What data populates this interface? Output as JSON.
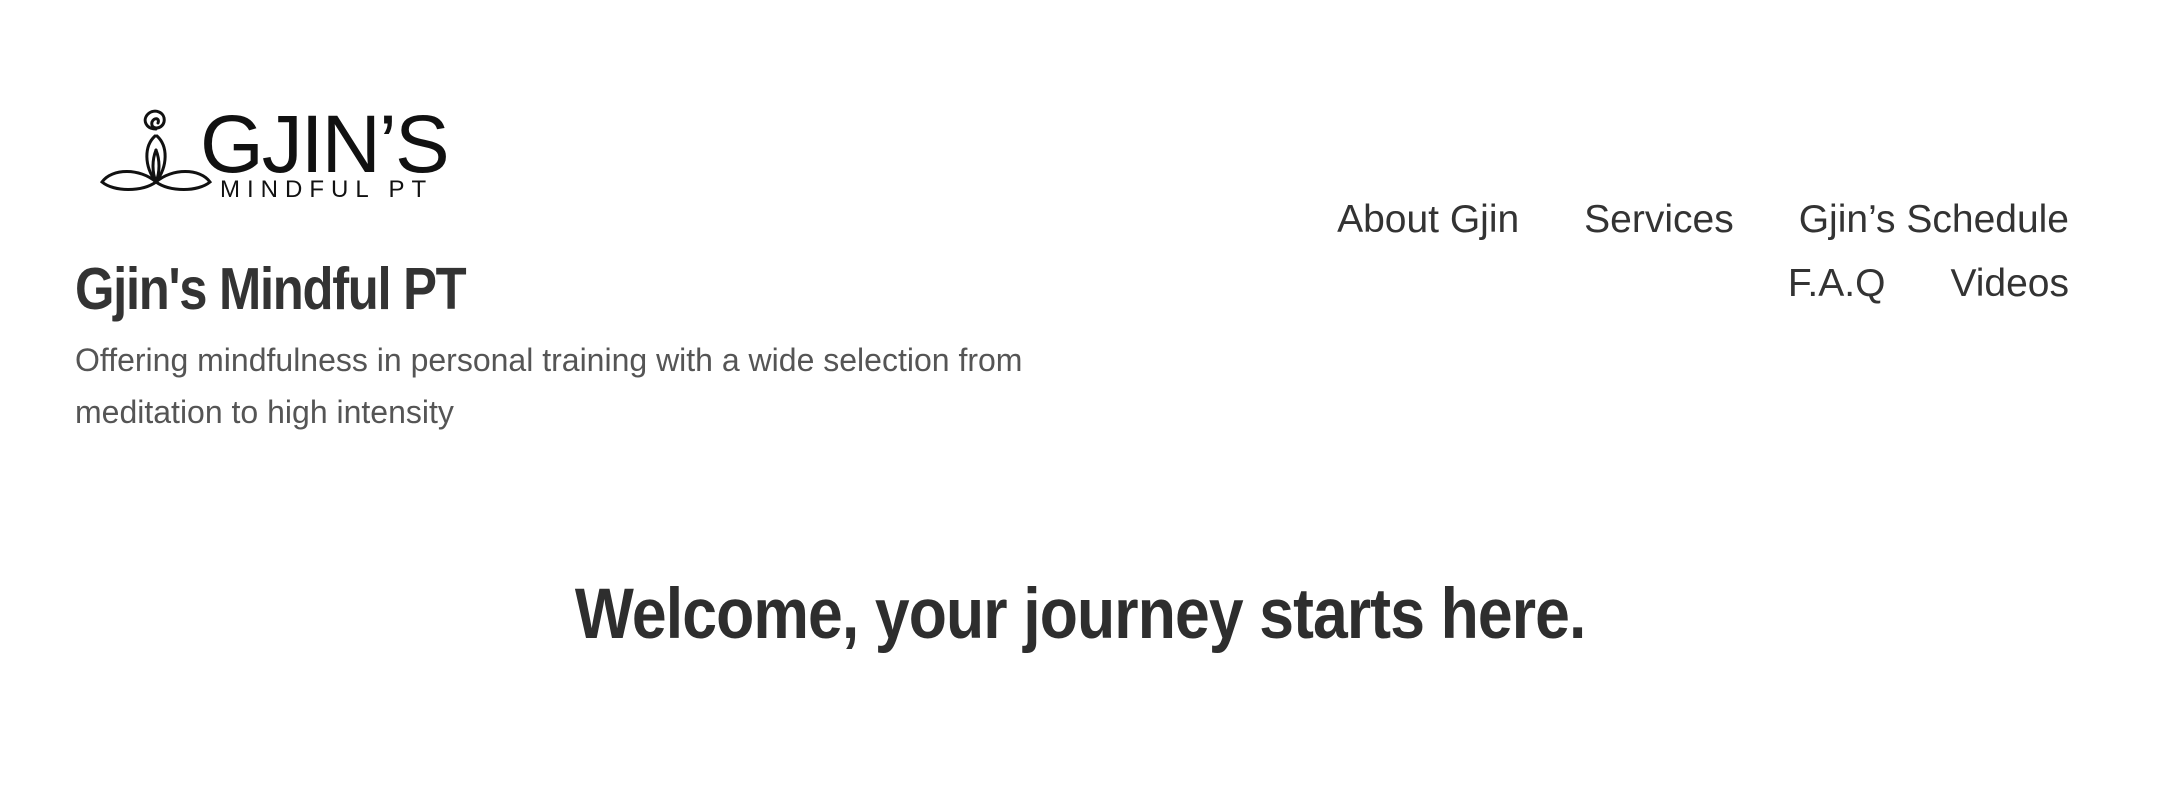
{
  "site": {
    "logo": {
      "brand_text": "GJIN’S",
      "brand_subtext": "MINDFUL PT",
      "icon": "meditating-lotus-figure-icon"
    },
    "title": "Gjin's Mindful PT",
    "tagline": "Offering mindfulness in personal training with a wide selection from meditation to high intensity"
  },
  "nav": {
    "row1": [
      "About Gjin",
      "Services",
      "Gjin’s Schedule"
    ],
    "row2": [
      "F.A.Q",
      "Videos"
    ]
  },
  "main": {
    "heading": "Welcome, your journey starts here."
  },
  "colors": {
    "text": "#333333",
    "tagline": "#555555",
    "background": "#ffffff"
  }
}
